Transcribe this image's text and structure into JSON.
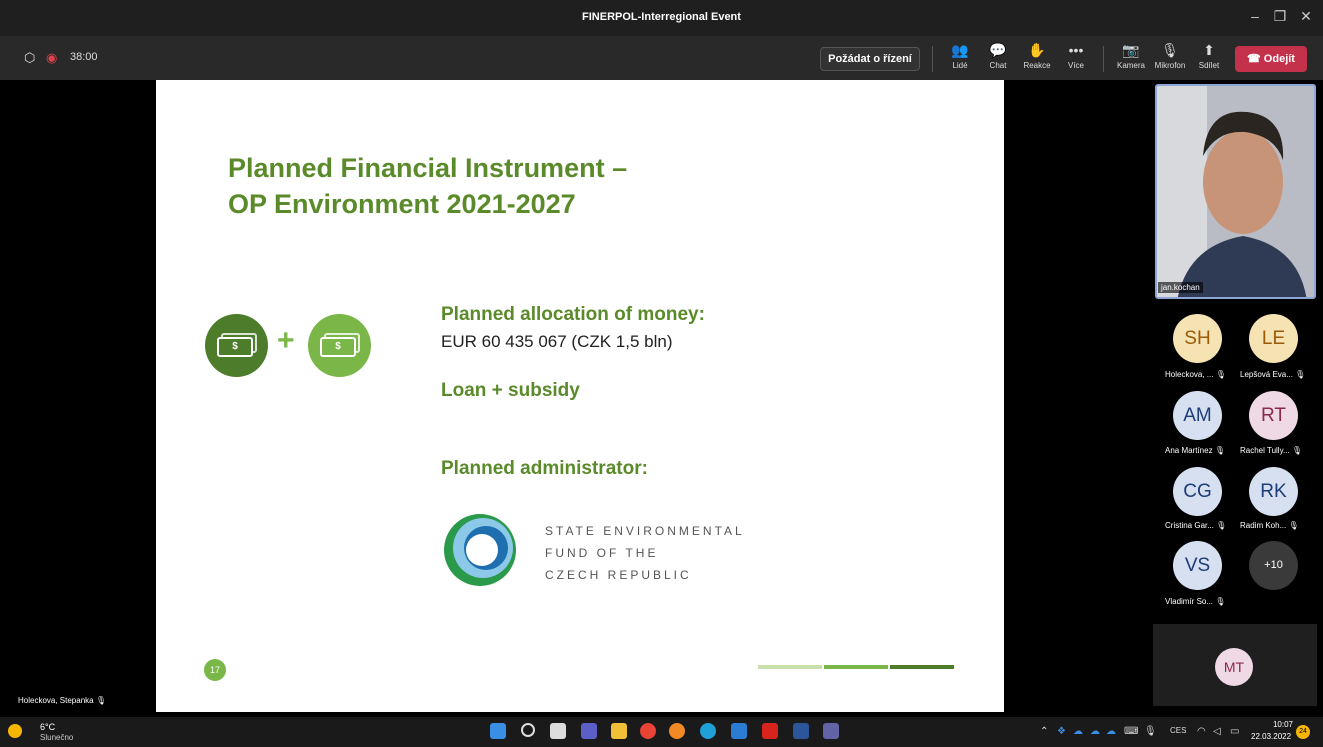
{
  "window": {
    "title": "FINERPOL-Interregional Event"
  },
  "meeting": {
    "timer": "38:00",
    "request_control": "Požádat o řízení",
    "tools": {
      "people": "Lidé",
      "chat": "Chat",
      "reactions": "Reakce",
      "more": "Více",
      "camera": "Kamera",
      "mic": "Mikrofon",
      "share": "Sdílet"
    },
    "leave": "Odejít"
  },
  "slide": {
    "title_line1": "Planned Financial Instrument –",
    "title_line2": "OP Environment 2021-2027",
    "allocation_heading": "Planned allocation of money:",
    "allocation_value": "EUR 60 435 067 (CZK 1,5 bln)",
    "loan": "Loan + subsidy",
    "admin_heading": "Planned administrator:",
    "sef_line1": "STATE ENVIRONMENTAL",
    "sef_line2": "FUND OF THE",
    "sef_line3": "CZECH REPUBLIC",
    "page_number": "17",
    "plus_sign": "+",
    "money_symbol": "$"
  },
  "presenter_label": "Holeckova, Stepanka",
  "speaker": {
    "name": "jan.kochan"
  },
  "participants": [
    {
      "initials": "SH",
      "name": "Holeckova, ...",
      "color": "#f6e3b4"
    },
    {
      "initials": "LE",
      "name": "Lepšová Eva...",
      "color": "#f6e3b4"
    },
    {
      "initials": "AM",
      "name": "Ana Martínez",
      "color": "#d6e0f0"
    },
    {
      "initials": "RT",
      "name": "Rachel Tully...",
      "color": "#efd9e4"
    },
    {
      "initials": "CG",
      "name": "Cristina Gar...",
      "color": "#d6e0f0"
    },
    {
      "initials": "RK",
      "name": "Radim Koh...",
      "color": "#d6e0f0"
    },
    {
      "initials": "VS",
      "name": "Vladimír So...",
      "color": "#d6e0f0"
    }
  ],
  "overflow": "+10",
  "spotlight": {
    "initials": "MT"
  },
  "taskbar": {
    "weather_temp": "6°C",
    "weather_desc": "Slunečno",
    "lang": "CES",
    "time": "10:07",
    "date": "22.03.2022",
    "notifications": "24"
  },
  "colors": {
    "accent_green": "#5a8a2a",
    "light_green": "#7ab648",
    "leave_red": "#c4314b"
  }
}
